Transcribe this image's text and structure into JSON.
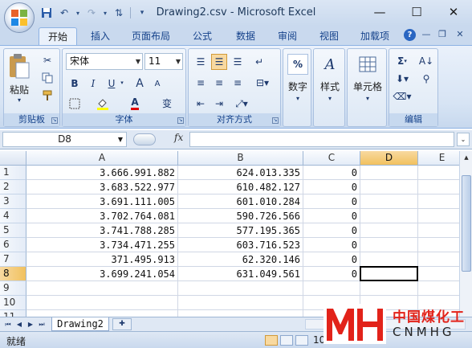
{
  "window": {
    "title": "Drawing2.csv - Microsoft Excel",
    "minimize_icon": "minimize-icon",
    "maximize_icon": "maximize-icon",
    "close_icon": "close-icon"
  },
  "qat": [
    "save-icon",
    "undo-icon",
    "redo-icon",
    "sort-icon",
    "qat-menu-icon"
  ],
  "tabs": [
    "开始",
    "插入",
    "页面布局",
    "公式",
    "数据",
    "审阅",
    "视图",
    "加载项"
  ],
  "active_tab": "开始",
  "ribbon": {
    "clipboard": {
      "label": "剪贴板",
      "paste": "粘贴"
    },
    "font": {
      "label": "字体",
      "font_name": "宋体",
      "font_size": "11",
      "bold": "B",
      "italic": "I",
      "underline": "U",
      "grow": "A",
      "shrink": "A",
      "phonetic": "变"
    },
    "alignment": {
      "label": "对齐方式"
    },
    "number": {
      "label": "数字",
      "percent": "%"
    },
    "styles": {
      "label": "样式"
    },
    "cells": {
      "label": "单元格"
    },
    "editing": {
      "label": "编辑",
      "sum": "Σ"
    }
  },
  "formula_bar": {
    "name_box": "D8",
    "fx": "fx",
    "value": ""
  },
  "columns": [
    "A",
    "B",
    "C",
    "D",
    "E"
  ],
  "rows": [
    {
      "n": "1",
      "a": "3.666.991.882",
      "b": "624.013.335",
      "c": "0"
    },
    {
      "n": "2",
      "a": "3.683.522.977",
      "b": "610.482.127",
      "c": "0"
    },
    {
      "n": "3",
      "a": "3.691.111.005",
      "b": "601.010.284",
      "c": "0"
    },
    {
      "n": "4",
      "a": "3.702.764.081",
      "b": "590.726.566",
      "c": "0"
    },
    {
      "n": "5",
      "a": "3.741.788.285",
      "b": "577.195.365",
      "c": "0"
    },
    {
      "n": "6",
      "a": "3.734.471.255",
      "b": "603.716.523",
      "c": "0"
    },
    {
      "n": "7",
      "a": "371.495.913",
      "b": "62.320.146",
      "c": "0"
    },
    {
      "n": "8",
      "a": "3.699.241.054",
      "b": "631.049.561",
      "c": "0"
    },
    {
      "n": "9",
      "a": "",
      "b": "",
      "c": ""
    },
    {
      "n": "10",
      "a": "",
      "b": "",
      "c": ""
    },
    {
      "n": "11",
      "a": "",
      "b": "",
      "c": ""
    }
  ],
  "selected_cell": "D8",
  "sheet_tab": "Drawing2",
  "status": {
    "text": "就绪",
    "zoom": "10"
  },
  "watermark": {
    "cn": "中国煤化工",
    "en": "CNMHG"
  },
  "colors": {
    "accent": "#15428b",
    "selection": "#f1c15f",
    "watermark_red": "#e2231a"
  }
}
